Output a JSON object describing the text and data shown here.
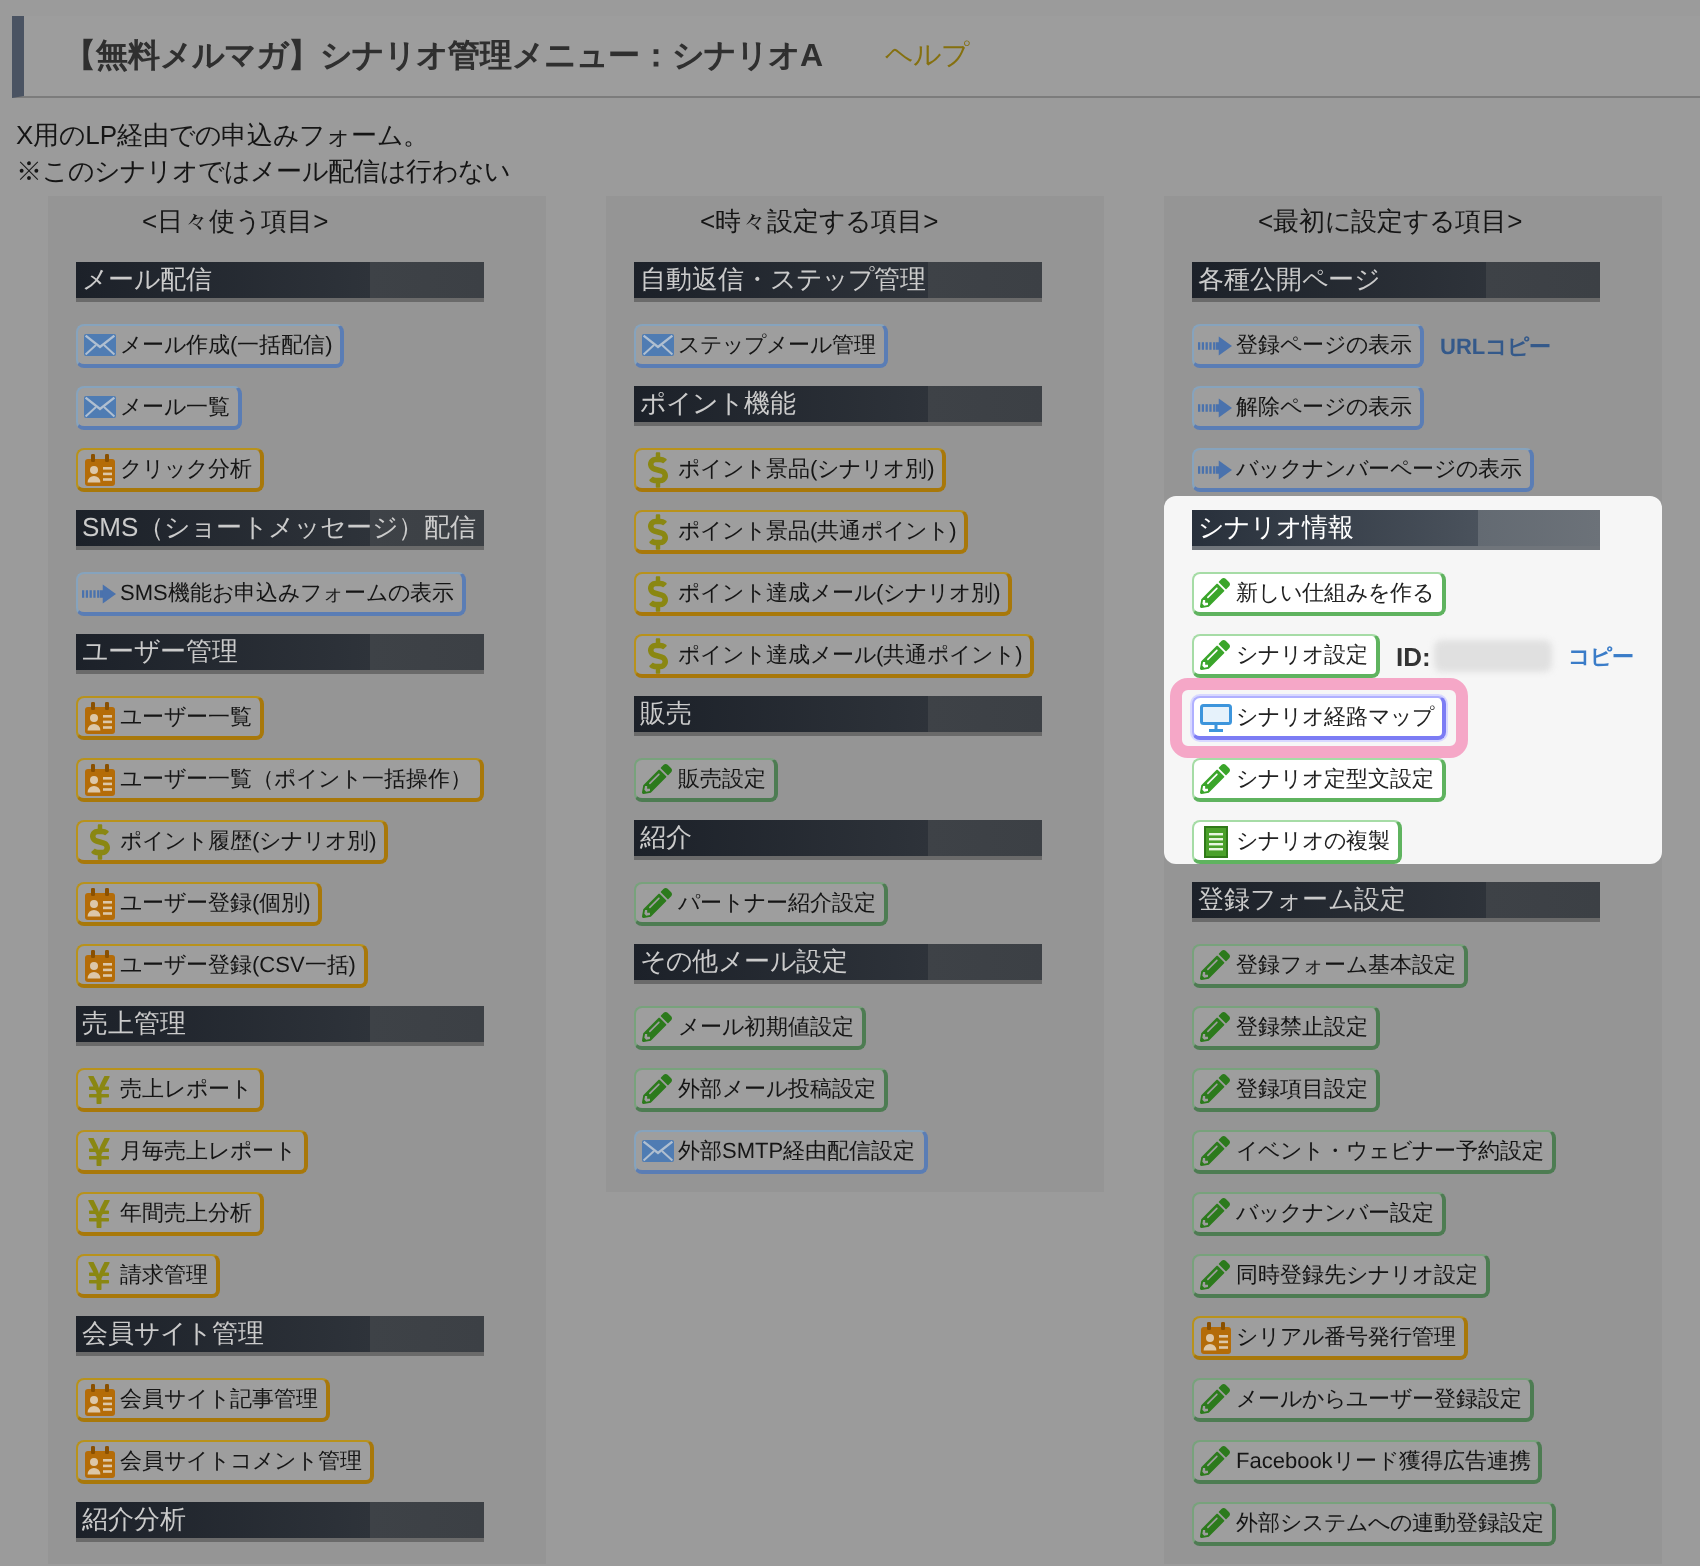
{
  "header": {
    "title": "【無料メルマガ】シナリオ管理メニュー：シナリオA",
    "help_link": "ヘルプ"
  },
  "description": [
    "X用のLP経由での申込みフォーム。",
    "※このシナリオではメール配信は行わない"
  ],
  "columns": [
    {
      "label": "<日々使う項目>",
      "sections": [
        {
          "title": "メール配信",
          "spotlight": false,
          "items": [
            {
              "kind": "mail",
              "label": "メール作成(一括配信)",
              "highlighted": false
            },
            {
              "kind": "mail",
              "label": "メール一覧",
              "highlighted": false
            },
            {
              "kind": "badge",
              "label": "クリック分析",
              "highlighted": false
            }
          ]
        },
        {
          "title": "SMS（ショートメッセージ）配信",
          "spotlight": false,
          "items": [
            {
              "kind": "arrow",
              "label": "SMS機能お申込みフォームの表示",
              "highlighted": false
            }
          ]
        },
        {
          "title": "ユーザー管理",
          "spotlight": false,
          "items": [
            {
              "kind": "badge",
              "label": "ユーザー一覧",
              "highlighted": false
            },
            {
              "kind": "badge",
              "label": "ユーザー一覧（ポイント一括操作）",
              "highlighted": false
            },
            {
              "kind": "dollar",
              "label": "ポイント履歴(シナリオ別)",
              "highlighted": false
            },
            {
              "kind": "badge",
              "label": "ユーザー登録(個別)",
              "highlighted": false
            },
            {
              "kind": "badge",
              "label": "ユーザー登録(CSV一括)",
              "highlighted": false
            }
          ]
        },
        {
          "title": "売上管理",
          "spotlight": false,
          "items": [
            {
              "kind": "yen",
              "label": "売上レポート",
              "highlighted": false
            },
            {
              "kind": "yen",
              "label": "月毎売上レポート",
              "highlighted": false
            },
            {
              "kind": "yen",
              "label": "年間売上分析",
              "highlighted": false
            },
            {
              "kind": "yen",
              "label": "請求管理",
              "highlighted": false
            }
          ]
        },
        {
          "title": "会員サイト管理",
          "spotlight": false,
          "items": [
            {
              "kind": "badge",
              "label": "会員サイト記事管理",
              "highlighted": false
            },
            {
              "kind": "badge",
              "label": "会員サイトコメント管理",
              "highlighted": false
            }
          ]
        },
        {
          "title": "紹介分析",
          "spotlight": false
        }
      ]
    },
    {
      "label": "<時々設定する項目>",
      "sections": [
        {
          "title": "自動返信・ステップ管理",
          "spotlight": false,
          "items": [
            {
              "kind": "mail",
              "label": "ステップメール管理",
              "highlighted": false
            }
          ]
        },
        {
          "title": "ポイント機能",
          "spotlight": false,
          "items": [
            {
              "kind": "dollar",
              "label": "ポイント景品(シナリオ別)",
              "highlighted": false
            },
            {
              "kind": "dollar",
              "label": "ポイント景品(共通ポイント)",
              "highlighted": false
            },
            {
              "kind": "dollar",
              "label": "ポイント達成メール(シナリオ別)",
              "highlighted": false
            },
            {
              "kind": "dollar",
              "label": "ポイント達成メール(共通ポイント)",
              "highlighted": false
            }
          ]
        },
        {
          "title": "販売",
          "spotlight": false,
          "items": [
            {
              "kind": "pencil",
              "label": "販売設定",
              "highlighted": false
            }
          ]
        },
        {
          "title": "紹介",
          "spotlight": false,
          "items": [
            {
              "kind": "pencil",
              "label": "パートナー紹介設定",
              "highlighted": false
            }
          ]
        },
        {
          "title": "その他メール設定",
          "spotlight": false,
          "items": [
            {
              "kind": "pencil",
              "label": "メール初期値設定",
              "highlighted": false
            },
            {
              "kind": "pencil",
              "label": "外部メール投稿設定",
              "highlighted": false
            },
            {
              "kind": "mail",
              "label": "外部SMTP経由配信設定",
              "highlighted": false
            }
          ]
        }
      ]
    },
    {
      "label": "<最初に設定する項目>",
      "sections": [
        {
          "title": "各種公開ページ",
          "spotlight": false,
          "items": [
            {
              "kind": "arrow",
              "label": "登録ページの表示",
              "highlighted": false,
              "link": "URLコピー"
            },
            {
              "kind": "arrow",
              "label": "解除ページの表示",
              "highlighted": false
            },
            {
              "kind": "arrow",
              "label": "バックナンバーページの表示",
              "highlighted": false
            }
          ]
        },
        {
          "title": "シナリオ情報",
          "spotlight": true,
          "items": [
            {
              "kind": "pencil",
              "label": "新しい仕組みを作る",
              "highlighted": false
            },
            {
              "kind": "pencil",
              "label": "シナリオ設定",
              "highlighted": false,
              "id_label": "ID:",
              "link": "コピー"
            },
            {
              "kind": "monitor",
              "label": "シナリオ経路マップ",
              "highlighted": true
            },
            {
              "kind": "pencil",
              "label": "シナリオ定型文設定",
              "highlighted": false
            },
            {
              "kind": "document",
              "label": "シナリオの複製",
              "highlighted": false
            }
          ]
        },
        {
          "title": "登録フォーム設定",
          "spotlight": false,
          "items": [
            {
              "kind": "pencil",
              "label": "登録フォーム基本設定",
              "highlighted": false
            },
            {
              "kind": "pencil",
              "label": "登録禁止設定",
              "highlighted": false
            },
            {
              "kind": "pencil",
              "label": "登録項目設定",
              "highlighted": false
            },
            {
              "kind": "pencil",
              "label": "イベント・ウェビナー予約設定",
              "highlighted": false
            },
            {
              "kind": "pencil",
              "label": "バックナンバー設定",
              "highlighted": false
            },
            {
              "kind": "pencil",
              "label": "同時登録先シナリオ設定",
              "highlighted": false
            },
            {
              "kind": "badge",
              "label": "シリアル番号発行管理",
              "highlighted": false
            },
            {
              "kind": "pencil",
              "label": "メールからユーザー登録設定",
              "highlighted": false
            },
            {
              "kind": "pencil",
              "label": "Facebookリード獲得広告連携",
              "highlighted": false
            },
            {
              "kind": "pencil",
              "label": "外部システムへの連動登録設定",
              "highlighted": false
            }
          ]
        }
      ]
    }
  ]
}
